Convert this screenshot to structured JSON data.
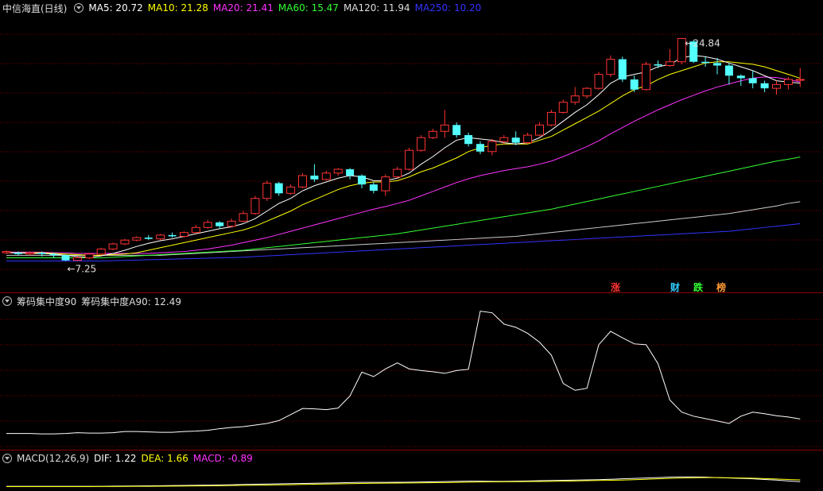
{
  "main_header": {
    "stock_name": "中信海直(日线)",
    "ma": [
      {
        "label": "MA5: 20.72",
        "color": "#ffffff"
      },
      {
        "label": "MA10: 21.28",
        "color": "#ffff00"
      },
      {
        "label": "MA20: 21.41",
        "color": "#ff33ff"
      },
      {
        "label": "MA60: 15.47",
        "color": "#33ff33"
      },
      {
        "label": "MA120: 11.94",
        "color": "#dddddd"
      },
      {
        "label": "MA250: 10.20",
        "color": "#3333ff"
      }
    ]
  },
  "annotations": {
    "high_label": "24.84",
    "low_label": "7.25"
  },
  "badges": [
    {
      "text": "涨",
      "color": "#ff3333"
    },
    {
      "text": "财",
      "color": "#33ccff"
    },
    {
      "text": "跌",
      "color": "#33ff33"
    },
    {
      "text": "榜",
      "color": "#ff9933"
    }
  ],
  "indicator_header": {
    "name": "筹码集中度90",
    "value_label": "筹码集中度A90: 12.49"
  },
  "macd_header": {
    "name": "MACD(12,26,9)",
    "dif": "DIF: 1.22",
    "dea": "DEA: 1.66",
    "macd": "MACD: -0.89"
  },
  "colors": {
    "up": "#ff3333",
    "down": "#54ffff",
    "ma5": "#ffffff",
    "ma10": "#ffff00",
    "ma20": "#ff33ff",
    "ma60": "#33ff33",
    "ma120": "#cccccc",
    "ma250": "#3333ff",
    "grid": "#7a0000"
  },
  "chart_data": [
    {
      "type": "candlestick",
      "price_range": [
        5.9,
        26.5
      ],
      "candles": [
        [
          7.9,
          8.0,
          8.1,
          7.8
        ],
        [
          7.9,
          7.8,
          8.0,
          7.7
        ],
        [
          7.8,
          7.9,
          8.0,
          7.7
        ],
        [
          7.9,
          7.8,
          8.0,
          7.6
        ],
        [
          7.8,
          7.7,
          7.9,
          7.5
        ],
        [
          7.7,
          7.3,
          7.8,
          7.25
        ],
        [
          7.3,
          7.5,
          7.6,
          7.25
        ],
        [
          7.5,
          7.8,
          7.9,
          7.4
        ],
        [
          7.8,
          8.2,
          8.3,
          7.7
        ],
        [
          8.2,
          8.6,
          8.7,
          8.1
        ],
        [
          8.6,
          8.9,
          9.0,
          8.5
        ],
        [
          8.9,
          9.1,
          9.2,
          8.8
        ],
        [
          9.1,
          9.0,
          9.3,
          8.9
        ],
        [
          9.0,
          9.3,
          9.4,
          8.9
        ],
        [
          9.3,
          9.2,
          9.5,
          9.1
        ],
        [
          9.2,
          9.5,
          9.6,
          9.1
        ],
        [
          9.5,
          9.9,
          10.1,
          9.4
        ],
        [
          9.9,
          10.3,
          10.5,
          9.8
        ],
        [
          10.3,
          10.0,
          10.4,
          9.8
        ],
        [
          10.0,
          10.4,
          10.6,
          9.9
        ],
        [
          10.4,
          11.0,
          11.2,
          10.3
        ],
        [
          11.0,
          12.2,
          12.4,
          10.9
        ],
        [
          12.2,
          13.4,
          13.6,
          12.0
        ],
        [
          13.4,
          12.6,
          13.5,
          12.4
        ],
        [
          12.6,
          13.1,
          13.3,
          12.5
        ],
        [
          13.1,
          14.0,
          14.2,
          13.0
        ],
        [
          14.0,
          13.7,
          14.9,
          13.5
        ],
        [
          13.7,
          14.2,
          14.4,
          13.6
        ],
        [
          14.2,
          14.5,
          14.6,
          14.0
        ],
        [
          14.5,
          14.0,
          14.6,
          13.7
        ],
        [
          14.0,
          13.3,
          14.1,
          13.0
        ],
        [
          13.3,
          12.8,
          13.5,
          12.6
        ],
        [
          12.8,
          13.9,
          14.1,
          12.4
        ],
        [
          13.9,
          14.5,
          14.7,
          13.8
        ],
        [
          14.5,
          16.0,
          16.2,
          14.4
        ],
        [
          16.0,
          17.0,
          17.2,
          15.9
        ],
        [
          17.0,
          17.5,
          17.7,
          16.9
        ],
        [
          17.5,
          18.0,
          19.2,
          17.0
        ],
        [
          18.0,
          17.2,
          18.2,
          17.0
        ],
        [
          17.2,
          16.5,
          17.4,
          16.3
        ],
        [
          16.5,
          15.9,
          16.7,
          15.7
        ],
        [
          15.9,
          16.7,
          16.9,
          15.6
        ],
        [
          16.7,
          17.0,
          17.2,
          16.5
        ],
        [
          17.0,
          16.6,
          17.5,
          16.4
        ],
        [
          16.6,
          17.2,
          17.4,
          16.5
        ],
        [
          17.2,
          18.0,
          18.2,
          17.1
        ],
        [
          18.0,
          19.0,
          19.2,
          17.9
        ],
        [
          19.0,
          19.8,
          20.0,
          18.9
        ],
        [
          19.8,
          20.3,
          21.0,
          19.6
        ],
        [
          20.3,
          20.9,
          21.0,
          20.1
        ],
        [
          20.9,
          22.0,
          22.2,
          20.8
        ],
        [
          22.0,
          23.2,
          23.5,
          21.8
        ],
        [
          23.2,
          21.6,
          23.4,
          21.4
        ],
        [
          21.6,
          20.8,
          21.9,
          20.6
        ],
        [
          20.8,
          22.8,
          23.0,
          20.7
        ],
        [
          22.8,
          22.7,
          23.1,
          22.5
        ],
        [
          22.7,
          23.0,
          24.0,
          22.6
        ],
        [
          23.0,
          24.84,
          24.84,
          22.8
        ],
        [
          24.6,
          23.0,
          24.7,
          22.9
        ],
        [
          23.0,
          22.9,
          23.4,
          22.6
        ],
        [
          22.9,
          22.7,
          23.3,
          22.0
        ],
        [
          22.7,
          21.9,
          22.9,
          21.2
        ],
        [
          21.9,
          21.7,
          22.0,
          21.1
        ],
        [
          21.7,
          21.3,
          22.3,
          20.9
        ],
        [
          21.3,
          20.9,
          21.5,
          20.6
        ],
        [
          20.9,
          21.2,
          21.5,
          20.4
        ],
        [
          21.2,
          21.6,
          21.8,
          20.8
        ],
        [
          21.6,
          21.6,
          22.5,
          21.0
        ]
      ],
      "ma_lines": {
        "ma5": [
          7.9,
          7.9,
          7.85,
          7.85,
          7.8,
          7.7,
          7.6,
          7.55,
          7.65,
          7.85,
          8.1,
          8.4,
          8.65,
          8.85,
          9.0,
          9.2,
          9.4,
          9.6,
          9.8,
          9.95,
          10.2,
          10.6,
          11.2,
          11.8,
          12.2,
          12.8,
          13.2,
          13.5,
          13.8,
          14.0,
          13.9,
          13.6,
          13.6,
          13.8,
          14.2,
          14.9,
          15.5,
          16.2,
          16.8,
          17.0,
          16.9,
          16.8,
          16.6,
          16.5,
          16.6,
          17.0,
          17.6,
          18.3,
          19.0,
          19.6,
          20.4,
          21.3,
          21.8,
          22.0,
          22.2,
          22.6,
          22.8,
          23.3,
          23.5,
          23.4,
          23.2,
          22.9,
          22.6,
          22.3,
          21.9,
          21.5,
          21.4,
          21.3
        ],
        "ma10": [
          7.9,
          7.9,
          7.9,
          7.9,
          7.85,
          7.8,
          7.75,
          7.7,
          7.7,
          7.75,
          7.8,
          7.9,
          8.1,
          8.3,
          8.5,
          8.7,
          8.9,
          9.1,
          9.3,
          9.5,
          9.7,
          10.0,
          10.4,
          10.8,
          11.2,
          11.7,
          12.1,
          12.5,
          12.9,
          13.2,
          13.4,
          13.5,
          13.5,
          13.6,
          13.9,
          14.3,
          14.6,
          15.0,
          15.4,
          15.9,
          16.2,
          16.4,
          16.5,
          16.5,
          16.5,
          16.8,
          17.1,
          17.6,
          18.1,
          18.6,
          19.1,
          19.7,
          20.3,
          20.8,
          21.1,
          21.6,
          22.0,
          22.3,
          22.6,
          22.9,
          23.0,
          23.0,
          22.9,
          22.8,
          22.6,
          22.3,
          22.0,
          21.7
        ],
        "ma20": [
          7.95,
          7.95,
          7.95,
          7.95,
          7.9,
          7.9,
          7.85,
          7.85,
          7.85,
          7.85,
          7.85,
          7.85,
          7.85,
          7.9,
          7.95,
          8.0,
          8.1,
          8.2,
          8.35,
          8.5,
          8.7,
          8.9,
          9.1,
          9.35,
          9.6,
          9.85,
          10.1,
          10.35,
          10.6,
          10.85,
          11.1,
          11.35,
          11.55,
          11.8,
          12.05,
          12.4,
          12.75,
          13.1,
          13.45,
          13.75,
          14.0,
          14.2,
          14.4,
          14.55,
          14.7,
          14.9,
          15.15,
          15.5,
          15.9,
          16.3,
          16.75,
          17.3,
          17.8,
          18.3,
          18.75,
          19.2,
          19.6,
          20.0,
          20.35,
          20.7,
          21.0,
          21.25,
          21.5,
          21.7,
          21.8,
          21.75,
          21.6,
          21.4
        ],
        "ma60": [
          7.5,
          7.5,
          7.5,
          7.5,
          7.5,
          7.5,
          7.5,
          7.5,
          7.5,
          7.55,
          7.6,
          7.65,
          7.7,
          7.75,
          7.8,
          7.85,
          7.9,
          7.95,
          8.0,
          8.05,
          8.1,
          8.2,
          8.3,
          8.4,
          8.5,
          8.6,
          8.7,
          8.8,
          8.9,
          9.0,
          9.1,
          9.2,
          9.3,
          9.4,
          9.55,
          9.7,
          9.85,
          10.0,
          10.15,
          10.3,
          10.45,
          10.6,
          10.75,
          10.9,
          11.05,
          11.2,
          11.35,
          11.55,
          11.75,
          11.95,
          12.15,
          12.35,
          12.55,
          12.75,
          12.95,
          13.15,
          13.35,
          13.55,
          13.75,
          13.95,
          14.15,
          14.35,
          14.55,
          14.75,
          14.95,
          15.15,
          15.3,
          15.47
        ],
        "ma120": [
          7.7,
          7.7,
          7.7,
          7.7,
          7.7,
          7.7,
          7.7,
          7.7,
          7.7,
          7.7,
          7.7,
          7.7,
          7.7,
          7.7,
          7.75,
          7.8,
          7.85,
          7.9,
          7.95,
          8.0,
          8.05,
          8.1,
          8.15,
          8.2,
          8.25,
          8.3,
          8.35,
          8.4,
          8.45,
          8.5,
          8.55,
          8.6,
          8.65,
          8.7,
          8.75,
          8.8,
          8.85,
          8.9,
          8.95,
          9.0,
          9.05,
          9.1,
          9.15,
          9.2,
          9.3,
          9.4,
          9.5,
          9.6,
          9.7,
          9.8,
          9.9,
          10.0,
          10.1,
          10.2,
          10.3,
          10.4,
          10.5,
          10.6,
          10.7,
          10.8,
          10.9,
          11.0,
          11.15,
          11.3,
          11.45,
          11.6,
          11.8,
          11.94
        ],
        "ma250": [
          7.25,
          7.25,
          7.25,
          7.25,
          7.25,
          7.25,
          7.25,
          7.25,
          7.25,
          7.27,
          7.3,
          7.32,
          7.35,
          7.37,
          7.4,
          7.42,
          7.45,
          7.47,
          7.5,
          7.52,
          7.55,
          7.6,
          7.65,
          7.7,
          7.75,
          7.8,
          7.85,
          7.9,
          7.95,
          8.0,
          8.05,
          8.1,
          8.15,
          8.2,
          8.25,
          8.3,
          8.35,
          8.4,
          8.45,
          8.5,
          8.55,
          8.6,
          8.65,
          8.7,
          8.75,
          8.8,
          8.85,
          8.9,
          8.95,
          9.0,
          9.05,
          9.1,
          9.15,
          9.2,
          9.25,
          9.3,
          9.35,
          9.4,
          9.45,
          9.5,
          9.55,
          9.6,
          9.7,
          9.8,
          9.9,
          10.0,
          10.1,
          10.2
        ]
      }
    },
    {
      "type": "line",
      "series": [
        {
          "values": [
            4,
            4,
            4,
            3.9,
            3.9,
            4,
            4.2,
            4.1,
            4.1,
            4.2,
            4.5,
            4.5,
            4.4,
            4.3,
            4.3,
            4.5,
            4.6,
            4.8,
            5.2,
            5.5,
            5.7,
            6.1,
            6.5,
            7.2,
            8.7,
            10.2,
            10.1,
            9.9,
            10.3,
            13.3,
            19.2,
            18.1,
            20.0,
            21.5,
            20.0,
            19.6,
            19.3,
            18.9,
            19.6,
            19.9,
            34.3,
            33.9,
            31.1,
            30.3,
            28.8,
            26.6,
            23.4,
            16.4,
            14.7,
            15.2,
            26.0,
            29.3,
            27.7,
            26.2,
            26.0,
            21.3,
            12.3,
            9.3,
            8.3,
            7.7,
            7.1,
            6.5,
            8.3,
            9.3,
            8.9,
            8.4,
            8.1,
            7.6
          ]
        }
      ],
      "ylim": [
        0,
        36
      ]
    },
    {
      "type": "line",
      "series": [
        {
          "name": "DIF",
          "values": [
            0.1,
            0.1,
            0.1,
            0.1,
            0.1,
            0.1,
            0.1,
            0.1,
            0.12,
            0.15,
            0.18,
            0.2,
            0.23,
            0.26,
            0.3,
            0.33,
            0.37,
            0.4,
            0.45,
            0.5,
            0.55,
            0.6,
            0.65,
            0.7,
            0.75,
            0.8,
            0.85,
            0.9,
            0.95,
            1.0,
            1.05,
            1.05,
            1.05,
            1.07,
            1.1,
            1.15,
            1.2,
            1.25,
            1.3,
            1.35,
            1.35,
            1.3,
            1.3,
            1.35,
            1.4,
            1.45,
            1.5,
            1.55,
            1.6,
            1.65,
            1.7,
            1.8,
            1.9,
            2.0,
            2.1,
            2.2,
            2.3,
            2.35,
            2.35,
            2.3,
            2.2,
            2.1,
            2.0,
            1.9,
            1.75,
            1.6,
            1.4,
            1.22
          ]
        },
        {
          "name": "DEA",
          "values": [
            0.05,
            0.05,
            0.05,
            0.05,
            0.05,
            0.05,
            0.05,
            0.05,
            0.06,
            0.07,
            0.08,
            0.1,
            0.12,
            0.14,
            0.16,
            0.18,
            0.2,
            0.23,
            0.26,
            0.3,
            0.34,
            0.38,
            0.42,
            0.46,
            0.5,
            0.55,
            0.6,
            0.65,
            0.7,
            0.75,
            0.8,
            0.85,
            0.88,
            0.9,
            0.92,
            0.95,
            0.98,
            1.0,
            1.05,
            1.1,
            1.15,
            1.18,
            1.2,
            1.22,
            1.25,
            1.28,
            1.3,
            1.35,
            1.4,
            1.45,
            1.5,
            1.55,
            1.6,
            1.7,
            1.8,
            1.9,
            2.0,
            2.1,
            2.15,
            2.2,
            2.2,
            2.15,
            2.1,
            2.05,
            1.95,
            1.85,
            1.75,
            1.66
          ]
        }
      ],
      "ylim": [
        -1,
        6
      ]
    }
  ]
}
